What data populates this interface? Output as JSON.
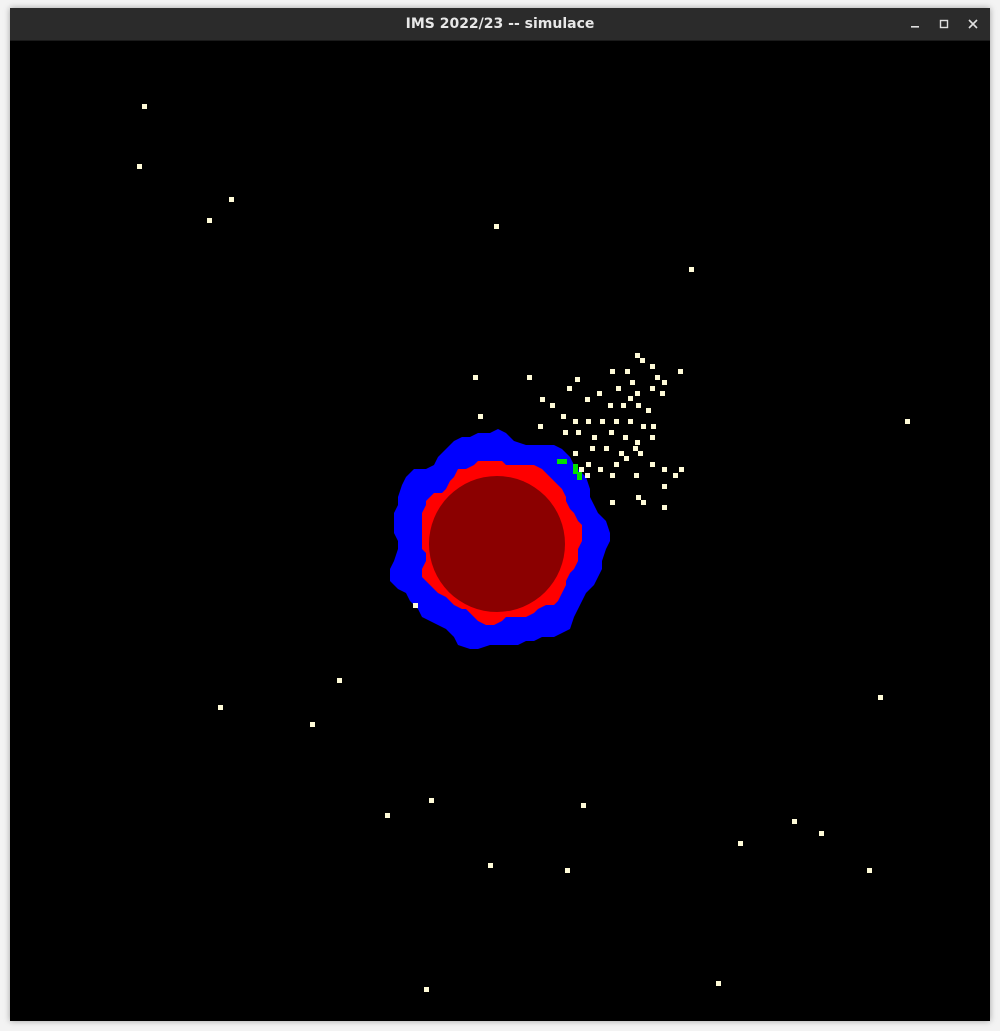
{
  "window": {
    "title": "IMS 2022/23 -- simulace",
    "controls": [
      {
        "name": "minimize-button",
        "icon": "minimize-icon"
      },
      {
        "name": "maximize-button",
        "icon": "maximize-icon"
      },
      {
        "name": "close-button",
        "icon": "close-icon"
      }
    ]
  },
  "simulation": {
    "colors": {
      "background": "#000000",
      "core": "#8b0000",
      "inner_ring": "#ff0000",
      "outer_ring": "#0000ff",
      "particle": "#fffbd8",
      "marker": "#00e000"
    }
  }
}
